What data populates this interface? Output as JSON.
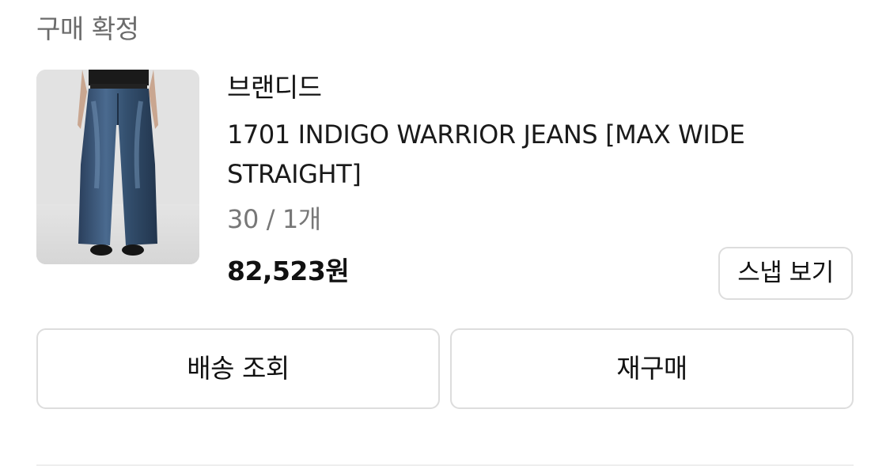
{
  "order": {
    "status": "구매 확정"
  },
  "product": {
    "image_alt": "jeans-product-photo",
    "brand": "브랜디드",
    "name": "1701 INDIGO WARRIOR JEANS [MAX WIDE STRAIGHT]",
    "option": "30 / 1개",
    "price": "82,523원"
  },
  "buttons": {
    "snap": "스냅 보기",
    "track_shipping": "배송 조회",
    "rebuy": "재구매"
  },
  "colors": {
    "text_primary": "#111111",
    "text_secondary": "#777777",
    "status_text": "#6b6b6b",
    "border": "#dddddd",
    "denim": "#2e4766"
  }
}
